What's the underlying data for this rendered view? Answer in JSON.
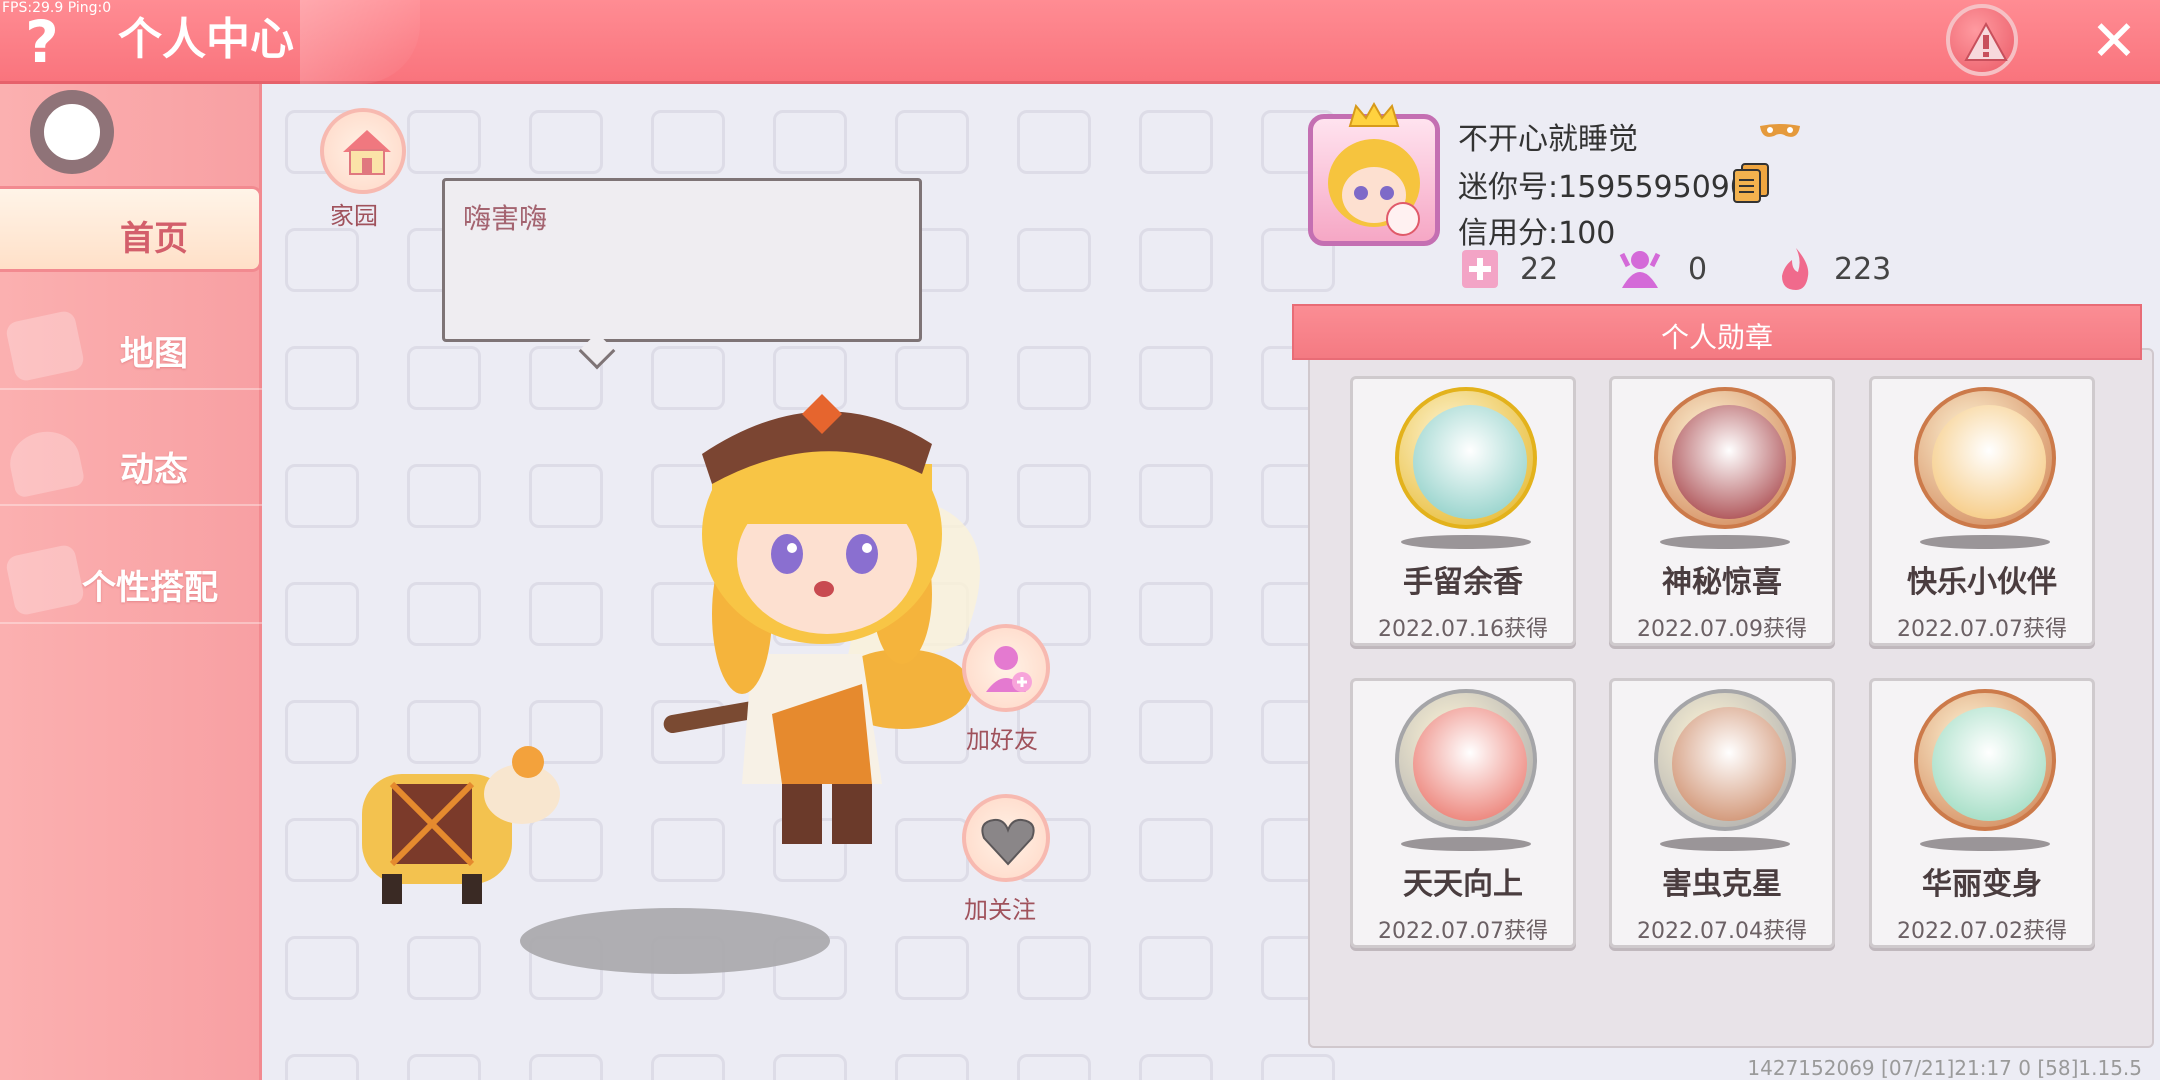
{
  "debug": {
    "fps": "FPS:29.9  Ping:0"
  },
  "header": {
    "title": "个人中心",
    "help_icon": "?",
    "close_icon": "✕"
  },
  "sidebar": {
    "items": [
      {
        "label": "首页",
        "active": true
      },
      {
        "label": "地图",
        "active": false
      },
      {
        "label": "动态",
        "active": false
      },
      {
        "label": "个性搭配",
        "active": false
      }
    ]
  },
  "main": {
    "home_label": "家园",
    "speech": "嗨害嗨",
    "add_friend_label": "加好友",
    "follow_label": "加关注"
  },
  "profile": {
    "name": "不开心就睡觉",
    "id_text": "迷你号:1595595090",
    "credit_text": "信用分:100",
    "stats": [
      {
        "icon": "plus-heart-icon",
        "value": "22"
      },
      {
        "icon": "fans-icon",
        "value": "0"
      },
      {
        "icon": "flame-icon",
        "value": "223"
      }
    ]
  },
  "badges": {
    "title": "个人勋章",
    "items": [
      {
        "name": "手留余香",
        "date": "2022.07.16获得",
        "ring": "#e3b21c",
        "inner": "#7ec9c0"
      },
      {
        "name": "神秘惊喜",
        "date": "2022.07.09获得",
        "ring": "#cc7a4a",
        "inner": "#9b2a2f"
      },
      {
        "name": "快乐小伙伴",
        "date": "2022.07.07获得",
        "ring": "#cc7a4a",
        "inner": "#f4c06a"
      },
      {
        "name": "天天向上",
        "date": "2022.07.07获得",
        "ring": "#a5a5a8",
        "inner": "#e8665a"
      },
      {
        "name": "害虫克星",
        "date": "2022.07.04获得",
        "ring": "#a5a5a8",
        "inner": "#c77d56"
      },
      {
        "name": "华丽变身",
        "date": "2022.07.02获得",
        "ring": "#cc7a4a",
        "inner": "#8fd6b8"
      }
    ]
  },
  "footer": {
    "info": "1427152069   [07/21]21:17 0   [58]1.15.5"
  }
}
